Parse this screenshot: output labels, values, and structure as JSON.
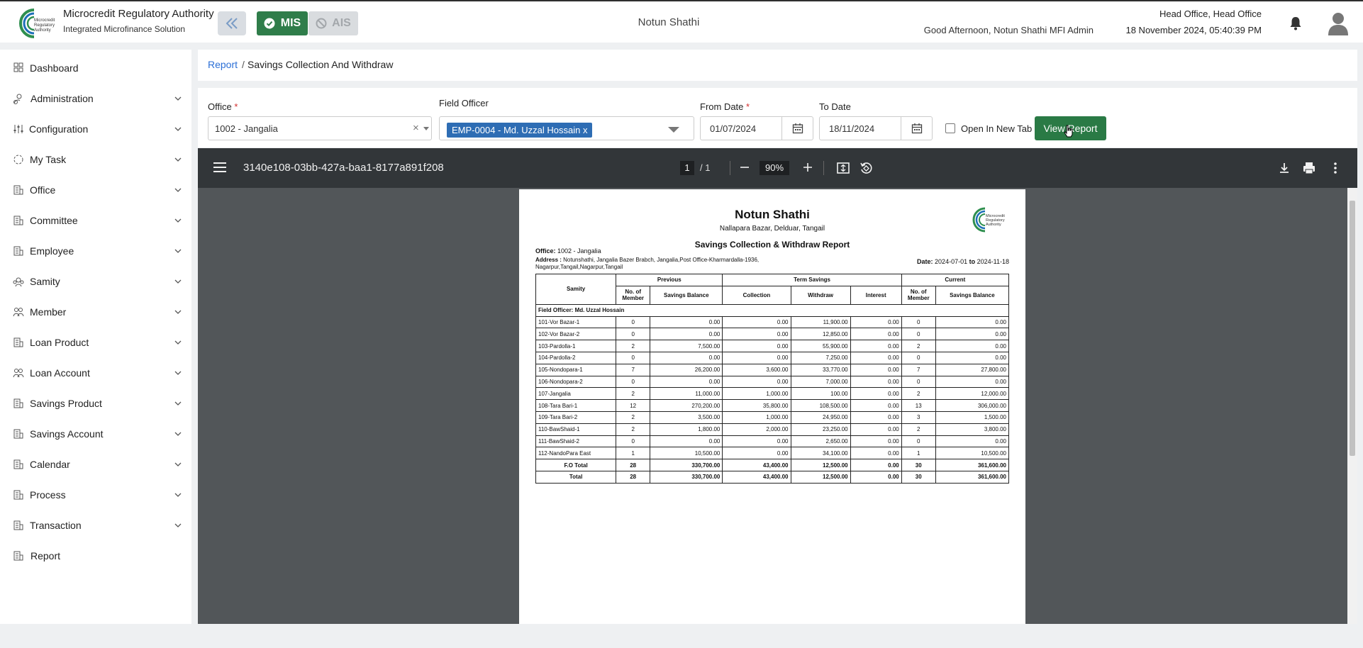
{
  "header": {
    "brand_title": "Microcredit Regulatory Authority",
    "brand_subtitle": "Integrated Microfinance Solution",
    "logo_text": "Microcredit Regulatory Authority",
    "mis_label": "MIS",
    "ais_label": "AIS",
    "center_title": "Notun Shathi",
    "office": "Head Office, Head Office",
    "greeting": "Good Afternoon, Notun Shathi MFI Admin",
    "datetime": "18 November 2024, 05:40:39 PM"
  },
  "sidebar": {
    "items": [
      {
        "label": "Dashboard",
        "icon": "dashboard-icon",
        "chevron": false
      },
      {
        "label": "Administration",
        "icon": "admin-icon",
        "chevron": true
      },
      {
        "label": "Configuration",
        "icon": "sliders-icon",
        "chevron": true
      },
      {
        "label": "My Task",
        "icon": "task-icon",
        "chevron": true
      },
      {
        "label": "Office",
        "icon": "office-icon",
        "chevron": true
      },
      {
        "label": "Committee",
        "icon": "committee-icon",
        "chevron": true
      },
      {
        "label": "Employee",
        "icon": "employee-icon",
        "chevron": true
      },
      {
        "label": "Samity",
        "icon": "samity-icon",
        "chevron": true
      },
      {
        "label": "Member",
        "icon": "member-icon",
        "chevron": true
      },
      {
        "label": "Loan Product",
        "icon": "loan-product-icon",
        "chevron": true
      },
      {
        "label": "Loan Account",
        "icon": "loan-account-icon",
        "chevron": true
      },
      {
        "label": "Savings Product",
        "icon": "savings-product-icon",
        "chevron": true
      },
      {
        "label": "Savings Account",
        "icon": "savings-account-icon",
        "chevron": true
      },
      {
        "label": "Calendar",
        "icon": "calendar-icon",
        "chevron": true
      },
      {
        "label": "Process",
        "icon": "process-icon",
        "chevron": true
      },
      {
        "label": "Transaction",
        "icon": "transaction-icon",
        "chevron": true
      },
      {
        "label": "Report",
        "icon": "report-icon",
        "chevron": false
      }
    ]
  },
  "breadcrumb": {
    "parent": "Report",
    "separator": "/",
    "current": "Savings Collection And Withdraw"
  },
  "filters": {
    "office_label": "Office",
    "office_value": "1002 - Jangalia",
    "officer_label": "Field Officer",
    "officer_chip": "EMP-0004 - Md. Uzzal Hossain",
    "officer_chip_remove": "x",
    "from_label": "From Date",
    "from_value": "01/07/2024",
    "to_label": "To Date",
    "to_value": "18/11/2024",
    "new_tab_label": "Open In New Tab",
    "view_button": "View Report",
    "required_mark": "*",
    "clear_mark": "×"
  },
  "viewer": {
    "file_name": "3140e108-03bb-427a-baa1-8177a891f208",
    "page_current": "1",
    "page_total": "/  1",
    "zoom": "90%"
  },
  "report": {
    "org_name": "Notun Shathi",
    "org_address": "Nallapara Bazar, Delduar, Tangail",
    "title": "Savings Collection & Withdraw Report",
    "logo_text": "Microcredit Regulatory Authority",
    "office_label": "Office:",
    "office_value": "1002 - Jangalia",
    "address_label": "Address :",
    "address_value": "Notunshathi, Jangalia Bazer Brabch, Jangalia,Post Office-Kharmardalla-1936, Nagarpur,Tangail,Nagarpur,Tangail",
    "date_label": "Date:",
    "date_from": "2024-07-01",
    "date_to_word": "to",
    "date_to": "2024-11-18",
    "headers": {
      "samity": "Samity",
      "previous": "Previous",
      "term_savings": "Term Savings",
      "current": "Current",
      "no_member": "No. of Member",
      "savings_balance": "Savings Balance",
      "collection": "Collection",
      "withdraw": "Withdraw",
      "interest": "Interest"
    },
    "field_officer_row": "Field Officer: Md. Uzzal Hossain",
    "rows": [
      [
        "101-Vor Bazar-1",
        "0",
        "0.00",
        "0.00",
        "11,900.00",
        "0.00",
        "0",
        "0.00"
      ],
      [
        "102-Vor Bazar-2",
        "0",
        "0.00",
        "0.00",
        "12,850.00",
        "0.00",
        "0",
        "0.00"
      ],
      [
        "103-Pardolla-1",
        "2",
        "7,500.00",
        "0.00",
        "55,900.00",
        "0.00",
        "2",
        "0.00"
      ],
      [
        "104-Pardolla-2",
        "0",
        "0.00",
        "0.00",
        "7,250.00",
        "0.00",
        "0",
        "0.00"
      ],
      [
        "105-Nondopara-1",
        "7",
        "26,200.00",
        "3,600.00",
        "33,770.00",
        "0.00",
        "7",
        "27,800.00"
      ],
      [
        "106-Nondopara-2",
        "0",
        "0.00",
        "0.00",
        "7,000.00",
        "0.00",
        "0",
        "0.00"
      ],
      [
        "107-Jangalia",
        "2",
        "11,000.00",
        "1,000.00",
        "100.00",
        "0.00",
        "2",
        "12,000.00"
      ],
      [
        "108-Tara Bari-1",
        "12",
        "270,200.00",
        "35,800.00",
        "108,500.00",
        "0.00",
        "13",
        "306,000.00"
      ],
      [
        "109-Tara Bari-2",
        "2",
        "3,500.00",
        "1,000.00",
        "24,950.00",
        "0.00",
        "3",
        "1,500.00"
      ],
      [
        "110-BawShaid-1",
        "2",
        "1,800.00",
        "2,000.00",
        "23,250.00",
        "0.00",
        "2",
        "3,800.00"
      ],
      [
        "111-BawShaid-2",
        "0",
        "0.00",
        "0.00",
        "2,650.00",
        "0.00",
        "0",
        "0.00"
      ],
      [
        "112-NandoPara East",
        "1",
        "10,500.00",
        "0.00",
        "34,100.00",
        "0.00",
        "1",
        "10,500.00"
      ]
    ],
    "fo_total": [
      "F.O Total",
      "28",
      "330,700.00",
      "43,400.00",
      "12,500.00",
      "0.00",
      "30",
      "361,600.00"
    ],
    "grand_total": [
      "Total",
      "28",
      "330,700.00",
      "43,400.00",
      "12,500.00",
      "0.00",
      "30",
      "361,600.00"
    ]
  },
  "colors": {
    "brand_green": "#2f7d4a",
    "link_blue": "#2b6fd6",
    "chip_blue": "#2e6db4",
    "viewer_toolbar": "#323639",
    "viewer_bg": "#525659"
  }
}
